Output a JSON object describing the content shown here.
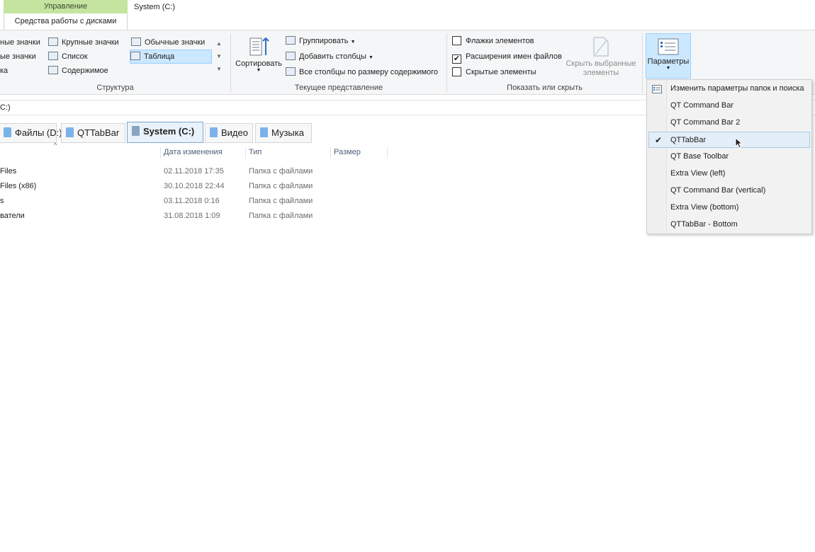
{
  "contextual_tab": {
    "group": "Управление",
    "label": "Средства работы с дисками"
  },
  "window_title": "System (C:)",
  "ribbon": {
    "layout": {
      "items_col1": [
        "ные значки",
        "ые значки",
        "ка"
      ],
      "items_col2": [
        "Крупные значки",
        "Список",
        "Содержимое"
      ],
      "items_col3": [
        "Обычные значки",
        "Таблица"
      ],
      "label": "Структура"
    },
    "current_view": {
      "sort_label": "Сортировать",
      "group_by": "Группировать",
      "add_columns": "Добавить столбцы",
      "size_columns": "Все столбцы по размеру содержимого",
      "label": "Текущее представление"
    },
    "show_hide": {
      "checkbox_items": "Флажки элементов",
      "file_extensions": "Расширения имен файлов",
      "hidden_items": "Скрытые элементы",
      "file_extensions_checked": true,
      "hide_selected": "Скрыть выбранные элементы",
      "label": "Показать или скрыть"
    },
    "options_label": "Параметры"
  },
  "address": "C:)",
  "tabs": [
    {
      "label": "Файлы (D:)"
    },
    {
      "label": "QTTabBar"
    },
    {
      "label": "System (C:)",
      "active": true
    },
    {
      "label": "Видео"
    },
    {
      "label": "Музыка"
    }
  ],
  "columns": {
    "date": "Дата изменения",
    "type": "Тип",
    "size": "Размер"
  },
  "rows": [
    {
      "name": "Files",
      "date": "02.11.2018 17:35",
      "type": "Папка с файлами"
    },
    {
      "name": "Files (x86)",
      "date": "30.10.2018 22:44",
      "type": "Папка с файлами"
    },
    {
      "name": "s",
      "date": "03.11.2018 0:16",
      "type": "Папка с файлами"
    },
    {
      "name": "ватели",
      "date": "31.08.2018 1:09",
      "type": "Папка с файлами"
    }
  ],
  "menu": {
    "items": [
      {
        "label": "Изменить параметры папок и поиска",
        "icon": "folder-options-icon"
      },
      {
        "label": "QT Command Bar"
      },
      {
        "label": "QT Command Bar 2"
      },
      {
        "label": "QTTabBar",
        "checked": true
      },
      {
        "label": "QT Base Toolbar"
      },
      {
        "label": "Extra View (left)"
      },
      {
        "label": "QT Command Bar (vertical)"
      },
      {
        "label": "Extra View (bottom)"
      },
      {
        "label": "QTTabBar - Bottom"
      }
    ]
  },
  "colors": {
    "context_tab": "#c5e4a0",
    "selection": "#cce8ff",
    "active_tab": "#e9f2fb"
  }
}
